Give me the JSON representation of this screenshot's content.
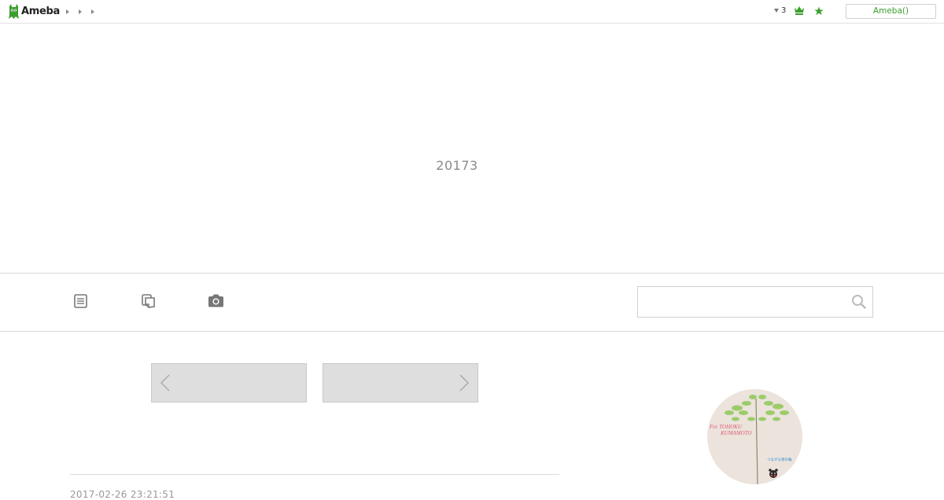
{
  "topbar": {
    "logo_text": "Ameba",
    "notification_count": "3",
    "login_label": "Ameba()"
  },
  "header": {
    "blog_title": "20173"
  },
  "nav": {
    "items": [
      "article-icon",
      "theme-list-icon",
      "camera-icon"
    ],
    "search_placeholder": ""
  },
  "pager": {
    "prev_label": "",
    "next_label": ""
  },
  "entry": {
    "date": "2017-02-26 23:21:51"
  },
  "profile": {
    "image_text_line1": "For TOHOKU",
    "image_text_line2": "KUMAMOTO",
    "image_caption": "つながる想の輪"
  },
  "colors": {
    "brand_green": "#3a9f2c",
    "divider": "#d9d9d9",
    "pager_bg": "#dedede"
  }
}
